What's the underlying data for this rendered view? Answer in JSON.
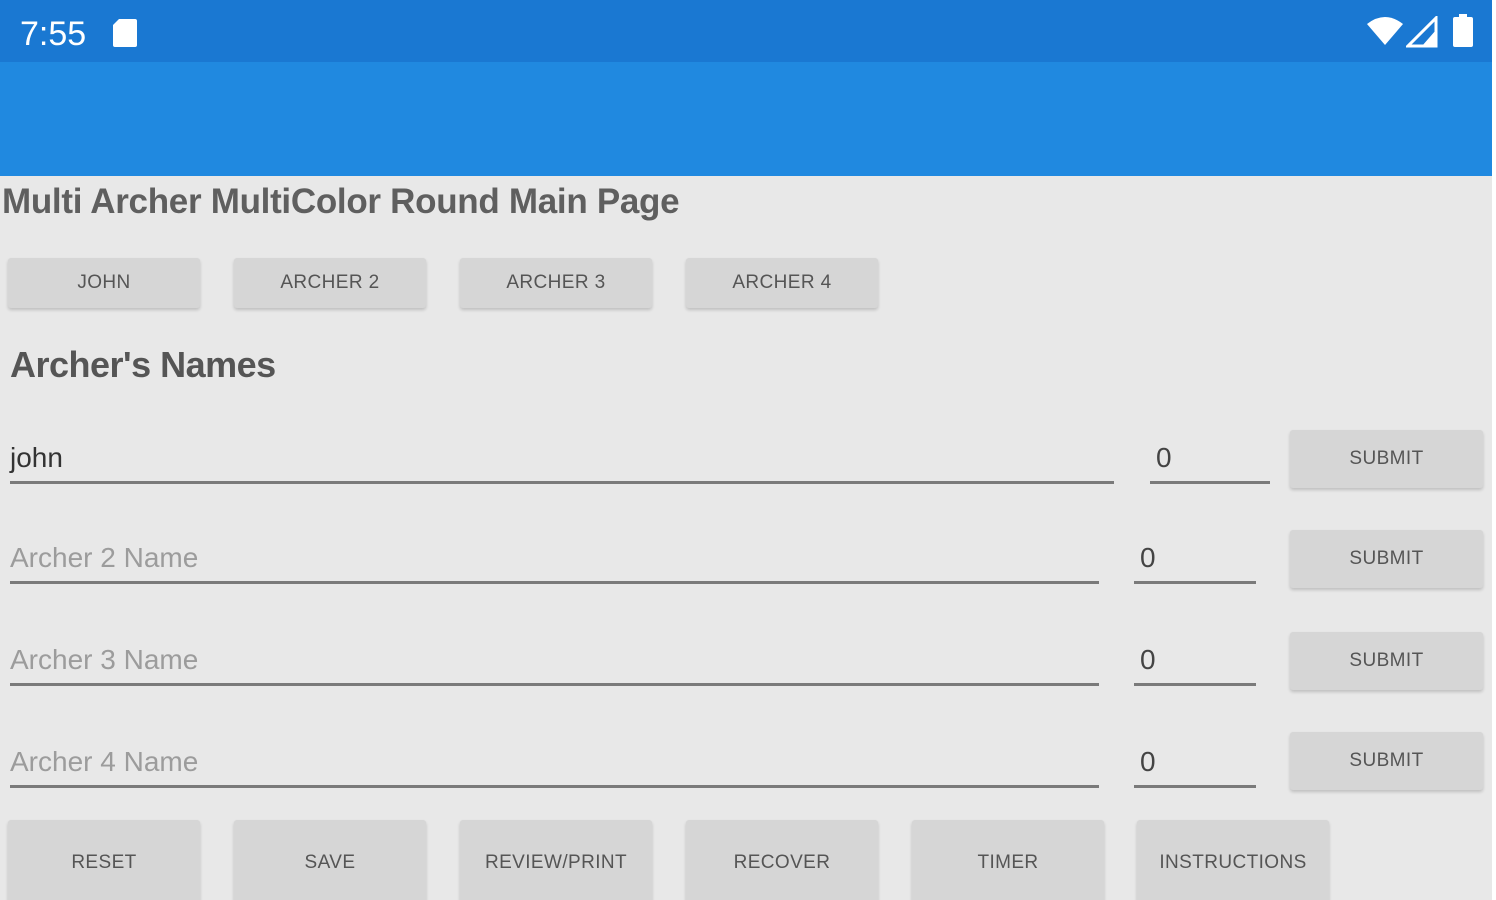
{
  "status_bar": {
    "time": "7:55",
    "icons": [
      "sd-card-icon",
      "wifi-icon",
      "cell-signal-icon",
      "battery-icon"
    ]
  },
  "page": {
    "title": "Multi Archer MultiColor Round Main Page"
  },
  "archer_tabs": [
    {
      "label": "JOHN"
    },
    {
      "label": "ARCHER 2"
    },
    {
      "label": "ARCHER 3"
    },
    {
      "label": "ARCHER 4"
    }
  ],
  "names_section": {
    "heading": "Archer's Names",
    "rows": [
      {
        "value": "john",
        "placeholder": "",
        "score": "0",
        "submit_label": "SUBMIT"
      },
      {
        "value": "",
        "placeholder": "Archer 2 Name",
        "score": "0",
        "submit_label": "SUBMIT"
      },
      {
        "value": "",
        "placeholder": "Archer 3 Name",
        "score": "0",
        "submit_label": "SUBMIT"
      },
      {
        "value": "",
        "placeholder": "Archer 4 Name",
        "score": "0",
        "submit_label": "SUBMIT"
      }
    ]
  },
  "bottom_actions": [
    {
      "label": "RESET"
    },
    {
      "label": "SAVE"
    },
    {
      "label": "REVIEW/PRINT"
    },
    {
      "label": "RECOVER"
    },
    {
      "label": "TIMER"
    },
    {
      "label": "INSTRUCTIONS"
    }
  ],
  "colors": {
    "status_bar": "#1a78d2",
    "app_bar": "#2089e0",
    "background": "#e8e8e8",
    "button": "#d6d6d6"
  }
}
